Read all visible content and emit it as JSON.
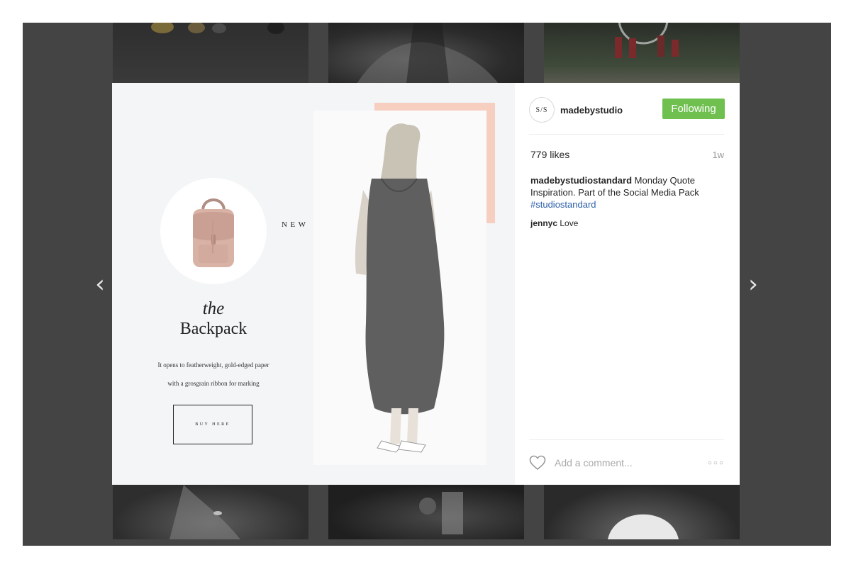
{
  "navigation": {
    "prev_icon": "‹",
    "next_icon": "›"
  },
  "post_media": {
    "heading": "NEW ARRIVAL",
    "product_prefix": "the",
    "product_name": "Backpack",
    "description_line1": "It opens to featherweight, gold-edged paper",
    "description_line2": "with a grosgrain ribbon for marking",
    "button_label": "BUY HERE"
  },
  "post": {
    "avatar_text": "S/S",
    "username": "madebystudio",
    "follow_button": "Following",
    "likes": "779 likes",
    "time_ago": "1w",
    "caption_user": "madebystudiostandard",
    "caption_text": "Monday Quote Inspiration. Part of the Social Media Pack",
    "hashtag": "#studiostandard",
    "comments": [
      {
        "user": "jennyc",
        "text": "Love"
      }
    ],
    "comment_placeholder": "Add a comment...",
    "more_icon": "○○○"
  },
  "colors": {
    "follow_green": "#70c050",
    "peach": "#f7cfc1",
    "hashtag_blue": "#2a5ea8",
    "overlay": "#444444"
  }
}
